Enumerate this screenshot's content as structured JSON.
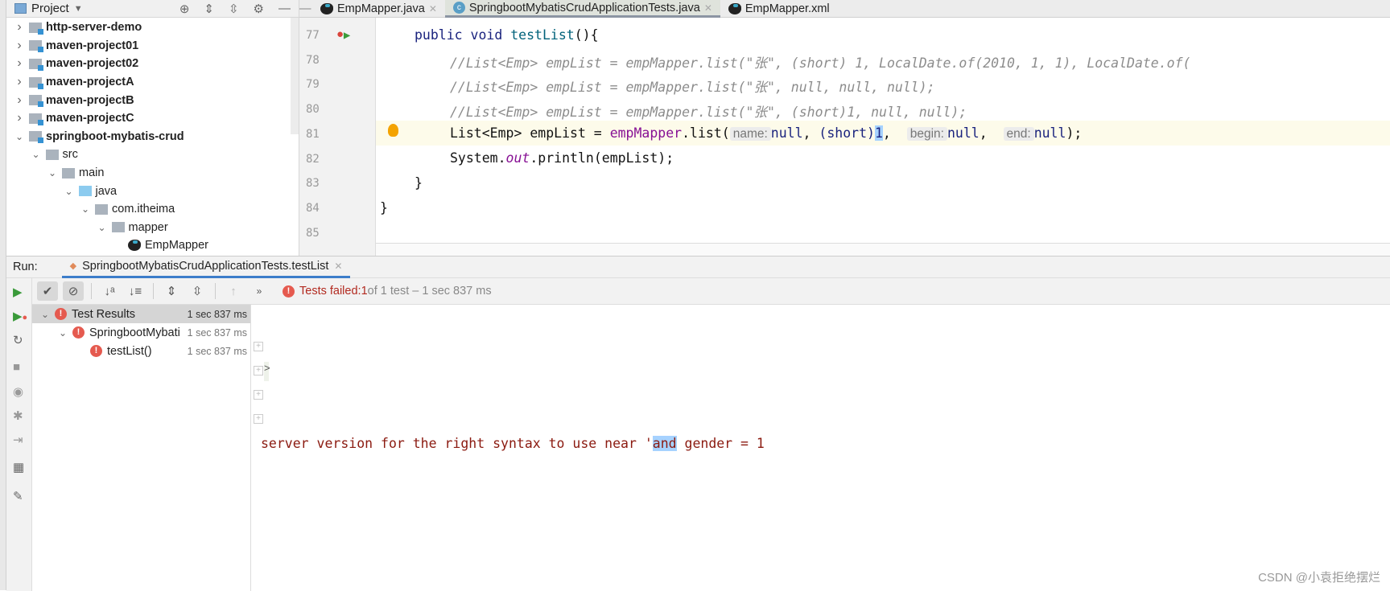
{
  "project": {
    "title": "Project",
    "items": [
      {
        "label": "http-server-demo",
        "bold": true,
        "level": 0,
        "open": false,
        "icon": "module-folder"
      },
      {
        "label": "maven-project01",
        "bold": true,
        "level": 0,
        "open": false,
        "icon": "module-folder"
      },
      {
        "label": "maven-project02",
        "bold": true,
        "level": 0,
        "open": false,
        "icon": "module-folder"
      },
      {
        "label": "maven-projectA",
        "bold": true,
        "level": 0,
        "open": false,
        "icon": "module-folder"
      },
      {
        "label": "maven-projectB",
        "bold": true,
        "level": 0,
        "open": false,
        "icon": "module-folder"
      },
      {
        "label": "maven-projectC",
        "bold": true,
        "level": 0,
        "open": false,
        "icon": "module-folder"
      },
      {
        "label": "springboot-mybatis-crud",
        "bold": true,
        "level": 0,
        "open": true,
        "icon": "module-folder"
      },
      {
        "label": "src",
        "level": 1,
        "open": true,
        "icon": "folder"
      },
      {
        "label": "main",
        "level": 2,
        "open": true,
        "icon": "folder"
      },
      {
        "label": "java",
        "level": 3,
        "open": true,
        "icon": "source-folder"
      },
      {
        "label": "com.itheima",
        "level": 4,
        "open": true,
        "icon": "package"
      },
      {
        "label": "mapper",
        "level": 5,
        "open": true,
        "icon": "package"
      },
      {
        "label": "EmpMapper",
        "level": 6,
        "icon": "mybatis-interface"
      }
    ]
  },
  "editor": {
    "tabs": [
      {
        "label": "EmpMapper.java",
        "icon": "mybatis-icon",
        "active": false
      },
      {
        "label": "SpringbootMybatisCrudApplicationTests.java",
        "icon": "class-icon",
        "active": true
      },
      {
        "label": "EmpMapper.xml",
        "icon": "mybatis-icon",
        "active": false
      }
    ],
    "line_numbers": [
      "77",
      "78",
      "79",
      "80",
      "81",
      "82",
      "83",
      "84",
      "85"
    ],
    "code": {
      "l77": [
        "public ",
        "void ",
        "testList",
        "(){"
      ],
      "l78": "//List<Emp> empList = empMapper.list(\"张\", (short) 1, LocalDate.of(2010, 1, 1), LocalDate.of(",
      "l79": "//List<Emp> empList = empMapper.list(\"张\", null, null, null);",
      "l80": "//List<Emp> empList = empMapper.list(\"张\", (short)1, null, null);",
      "l81": {
        "a": "List<Emp> empList = ",
        "b": "empMapper",
        ".list": ".list(",
        "h1": "name:",
        "v1": "null",
        ",1": ", ",
        "s": "(short)",
        "one": "1",
        ",2": ",  ",
        "h2": "begin:",
        "v2": "null",
        ",3": ",  ",
        "h3": "end:",
        "v3": "null",
        "end": ");"
      },
      "l82": {
        "a": "System.",
        "b": "out",
        "c": ".println(empList);"
      },
      "l83": "}",
      "l84": "}"
    }
  },
  "run": {
    "label": "Run:",
    "tab": "SpringbootMybatisCrudApplicationTests.testList",
    "status": {
      "failed": "Tests failed: ",
      "count": "1",
      "rest": " of 1 test – 1 sec 837 ms"
    },
    "tree": [
      {
        "label": "Test Results",
        "time": "1 sec 837 ms",
        "level": 0
      },
      {
        "label": "SpringbootMybati",
        "time": "1 sec 837 ms",
        "level": 1
      },
      {
        "label": "testList()",
        "time": "1 sec 837 ms",
        "level": 2
      }
    ],
    "console": {
      "arrow": ">",
      "error_pre": "server version for the right syntax to use near '",
      "error_sel": "and",
      "error_post": " gender = 1"
    }
  },
  "watermark": "CSDN @小袁拒绝摆烂"
}
